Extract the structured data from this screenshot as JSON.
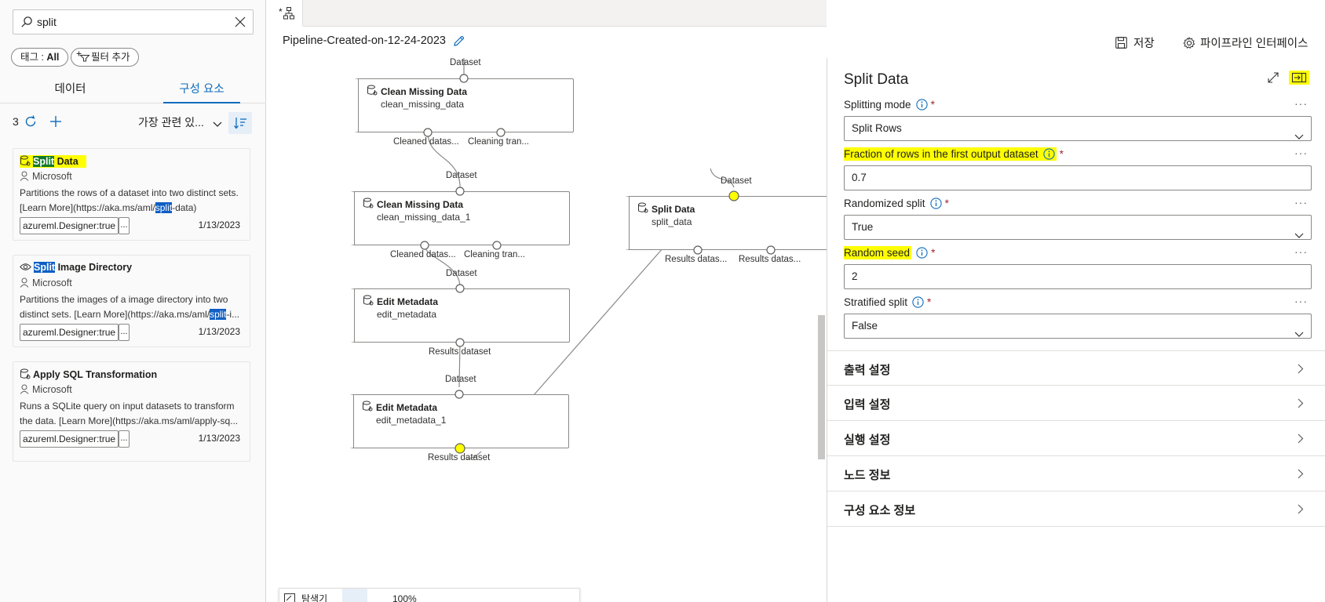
{
  "search": {
    "value": "split",
    "placeholder": ""
  },
  "filters": {
    "tag_prefix": "태그 : ",
    "tag_value": "All",
    "add_filter": "필터 추가"
  },
  "library_tabs": [
    {
      "label": "데이터"
    },
    {
      "label": "구성 요소"
    }
  ],
  "results": {
    "count": "3",
    "sort_label": "가장 관련 있..."
  },
  "cards": [
    {
      "title_hl": "Split",
      "title_rest": " Data",
      "author": "Microsoft",
      "desc_line1": "Partitions the rows of a dataset into two distinct sets.",
      "desc_line2_a": "[Learn More](https://aka.ms/aml/",
      "desc_line2_hl": "split",
      "desc_line2_b": "-data)",
      "tag": "azureml.Designer:true",
      "more": "...",
      "date": "1/13/2023"
    },
    {
      "title_hl": "Split",
      "title_rest": " Image Directory",
      "author": "Microsoft",
      "desc_line1": "Partitions the images of a image directory into two",
      "desc_line2_a": "distinct sets. [Learn More](https://aka.ms/aml/",
      "desc_line2_hl": "split",
      "desc_line2_b": "-i...",
      "tag": "azureml.Designer:true",
      "more": "...",
      "date": "1/13/2023"
    },
    {
      "title": "Apply SQL Transformation",
      "author": "Microsoft",
      "desc_line1": "Runs a SQLite query on input datasets to transform",
      "desc_line2": "the data. [Learn More](https://aka.ms/aml/apply-sq...",
      "tag": "azureml.Designer:true",
      "more": "...",
      "date": "1/13/2023"
    }
  ],
  "canvas": {
    "doc_tab_label": "*",
    "pipeline_name": "Pipeline-Created-on-12-24-2023",
    "save": "저장",
    "interface": "파이프라인 인터페이스",
    "nodes": [
      {
        "name": "Clean Missing Data",
        "id": "clean_missing_data",
        "in_label": "Dataset",
        "out1": "Cleaned datas...",
        "out2": "Cleaning tran..."
      },
      {
        "name": "Clean Missing Data",
        "id": "clean_missing_data_1",
        "in_label": "Dataset",
        "out1": "Cleaned datas...",
        "out2": "Cleaning tran..."
      },
      {
        "name": "Edit Metadata",
        "id": "edit_metadata",
        "in_label": "Dataset",
        "out1": "Results dataset"
      },
      {
        "name": "Edit Metadata",
        "id": "edit_metadata_1",
        "in_label": "Dataset",
        "out1": "Results dataset"
      },
      {
        "name": "Split Data",
        "id": "split_data",
        "in_label": "Dataset",
        "out1": "Results datas...",
        "out2": "Results datas..."
      }
    ],
    "zoom": {
      "explorer": "탐색기",
      "level": "100%"
    }
  },
  "props": {
    "title": "Split Data",
    "fields": [
      {
        "label": "Splitting mode",
        "value": "Split Rows",
        "type": "select"
      },
      {
        "label": "Fraction of rows in the first output dataset",
        "value": "0.7",
        "type": "text"
      },
      {
        "label": "Randomized split",
        "value": "True",
        "type": "select"
      },
      {
        "label": "Random seed",
        "value": "2",
        "type": "text"
      },
      {
        "label": "Stratified split",
        "value": "False",
        "type": "select"
      }
    ],
    "required_mark": "*",
    "more": "···",
    "sections": [
      {
        "label": "출력 설정"
      },
      {
        "label": "입력 설정"
      },
      {
        "label": "실행 설정"
      },
      {
        "label": "노드 정보"
      },
      {
        "label": "구성 요소 정보"
      }
    ]
  },
  "colors": {
    "accent": "#0f6cbd",
    "highlight": "#ffff00",
    "port_highlight": "#ffff00"
  },
  "icons": [
    "search-icon",
    "clear-icon",
    "filter-icon",
    "refresh-icon",
    "add-icon",
    "chevron-down-icon",
    "sort-icon",
    "module-icon",
    "eye-icon",
    "person-icon",
    "edit-icon",
    "save-icon",
    "gear-icon",
    "expand-icon",
    "dock-icon",
    "info-icon",
    "chevron-right-icon",
    "pipeline-icon"
  ]
}
